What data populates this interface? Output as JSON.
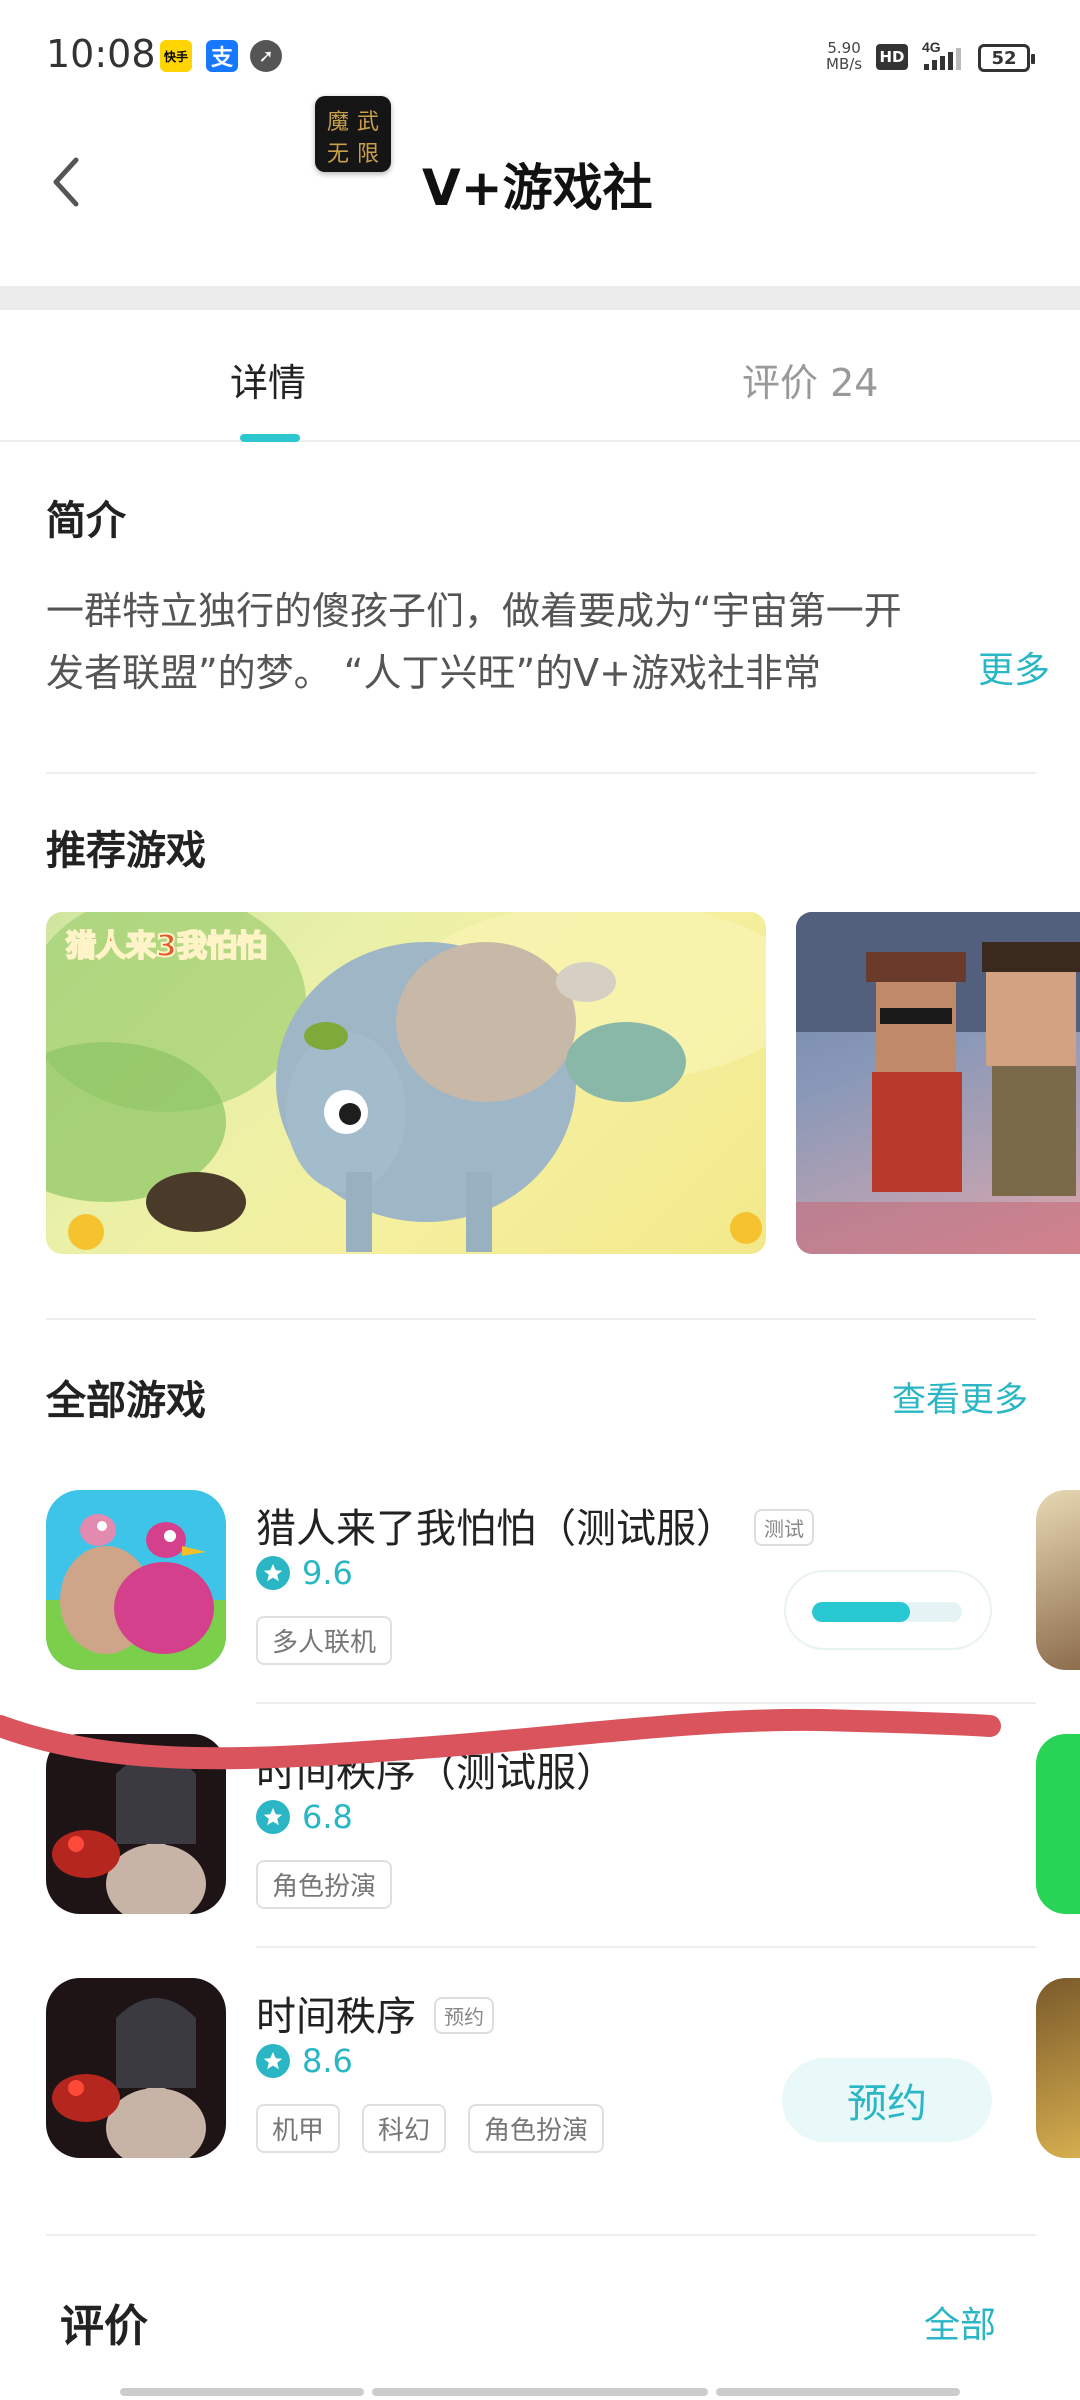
{
  "status_bar": {
    "time": "10:08",
    "apps": [
      "快手",
      "支付宝",
      "compass"
    ],
    "speed_value": "5.90",
    "speed_unit": "MB/s",
    "hd": "HD",
    "network": "4G",
    "battery": "52"
  },
  "header": {
    "back_icon": "chevron-left-icon",
    "logo_chars": [
      "魔",
      "武",
      "无",
      "限"
    ],
    "title": "V+游戏社"
  },
  "tabs": [
    {
      "label": "详情",
      "active": true
    },
    {
      "label": "评价 24",
      "active": false
    }
  ],
  "intro": {
    "title": "简介",
    "line1": "一群特立独行的傻孩子们，做着要成为“宇宙第一开",
    "line2": "发者联盟”的梦。 “人丁兴旺”的V+游戏社非常",
    "more": "更多"
  },
  "recommended": {
    "title": "推荐游戏",
    "banner1_logo_text": "猎人来3我怕怕"
  },
  "all_games": {
    "title": "全部游戏",
    "view_more": "查看更多",
    "items": [
      {
        "name": "猎人来了我怕怕（测试服）",
        "badge": "测试",
        "rating": "9.6",
        "tags": [
          "多人联机"
        ],
        "action": "progress",
        "progress": 0.65
      },
      {
        "name": "时间秩序（测试服）",
        "badge": "",
        "rating": "6.8",
        "tags": [
          "角色扮演"
        ],
        "action": "none"
      },
      {
        "name": "时间秩序",
        "badge": "预约",
        "rating": "8.6",
        "tags": [
          "机甲",
          "科幻",
          "角色扮演"
        ],
        "action": "预约"
      }
    ]
  },
  "reviews": {
    "title": "评价",
    "all": "全部"
  },
  "colors": {
    "accent": "#2ab6c4",
    "progress": "#27c8d2",
    "scribble": "#d9545c"
  }
}
